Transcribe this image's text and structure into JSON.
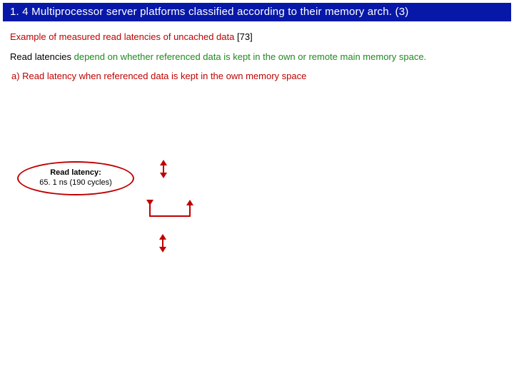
{
  "title": "1. 4 Multiprocessor server platforms classified according to their memory arch. (3)",
  "example_label": "Example of measured read latencies of uncached data",
  "example_ref": "[73]",
  "line2_a": "Read latencies",
  "line2_b": " depend on whether referenced data is kept in the own or remote main memory space.",
  "line3": "a) Read latency when referenced data is kept in the own memory space",
  "latency": {
    "label": "Read latency:",
    "value": "65. 1 ns (190 cycles)"
  }
}
